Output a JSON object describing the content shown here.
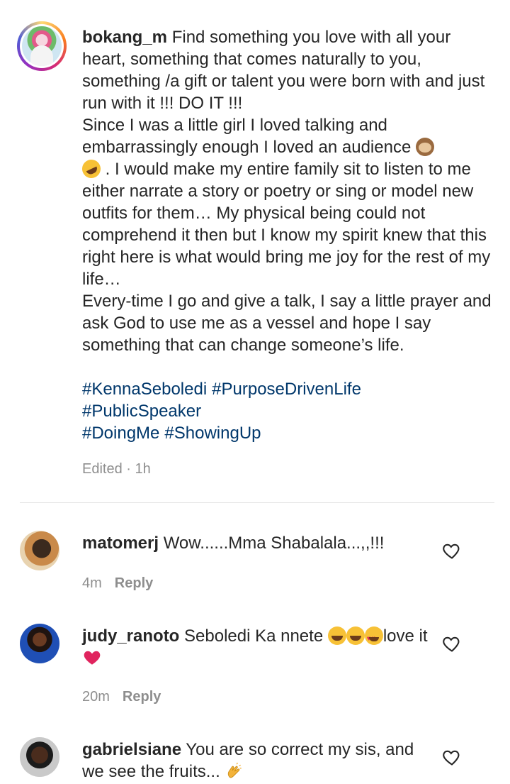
{
  "post": {
    "username": "bokang_m",
    "caption": " Find something you love with all your heart, something that comes naturally to you, something /a gift or talent you were born with and just run with it !!! DO IT !!!\nSince I was a little girl I loved talking and embarrassingly enough I loved an audience",
    "caption_part2": " . I would make my entire family sit to listen to me either narrate a story or poetry or sing or model new outfits for them… My physical being could not comprehend it then but I know my spirit knew that this right here is what would bring me joy for the rest of my life…\nEvery-time I go and give a talk, I say a little prayer and ask God to use me as a vessel and hope I say something that can change someone’s life.",
    "hashtags_line1": [
      "#KennaSeboledi",
      "#PurposeDrivenLife"
    ],
    "hashtags_line2": [
      "#PublicSpeaker"
    ],
    "hashtags_line3": [
      "#DoingMe",
      "#ShowingUp"
    ],
    "edited": "Edited · 1h"
  },
  "comments": [
    {
      "username": "matomerj",
      "text": " Wow......Mma Shabalala...,,!!!",
      "time": "4m",
      "reply": "Reply"
    },
    {
      "username": "judy_ranoto",
      "text": " Seboledi Ka nnete ",
      "text_after": "love it",
      "time": "20m",
      "reply": "Reply"
    },
    {
      "username": "gabrielsiane",
      "text": " You are so correct my sis, and we see the fruits... "
    }
  ],
  "colors": {
    "text": "#262626",
    "muted": "#8e8e8e",
    "hashtag": "#00376b",
    "heart": "#e0245e"
  },
  "icons": {
    "like": "heart-outline-icon"
  }
}
